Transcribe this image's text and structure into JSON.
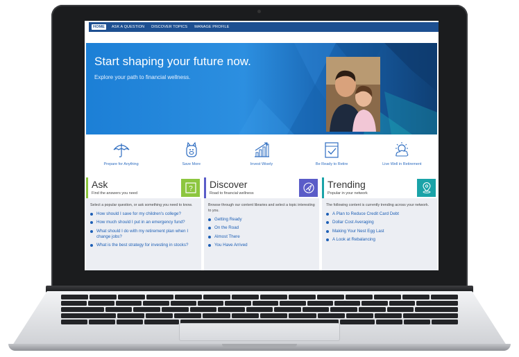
{
  "nav": {
    "items": [
      {
        "label": "HOME",
        "active": true
      },
      {
        "label": "ASK A QUESTION",
        "active": false
      },
      {
        "label": "DISCOVER TOPICS",
        "active": false
      },
      {
        "label": "MANAGE PROFILE",
        "active": false
      }
    ]
  },
  "hero": {
    "title": "Start shaping your future now.",
    "subtitle": "Explore your path to financial wellness."
  },
  "categories": [
    {
      "label": "Prepare for Anything",
      "icon": "umbrella-icon"
    },
    {
      "label": "Save More",
      "icon": "piggy-bank-icon"
    },
    {
      "label": "Invest Wisely",
      "icon": "growth-chart-icon"
    },
    {
      "label": "Be Ready to Retire",
      "icon": "calendar-check-icon"
    },
    {
      "label": "Live Well in Retirement",
      "icon": "sun-cloud-icon"
    }
  ],
  "cards": {
    "ask": {
      "title": "Ask",
      "subtitle": "Find the answers you need",
      "intro": "Select a popular question, or ask something you need to know.",
      "icon": "question-icon",
      "color": "#8dc63f",
      "items": [
        "How should I save for my children's college?",
        "How much should I put in an emergency fund?",
        "What should I do with my retirement plan when I change jobs?",
        "What is the best strategy for investing in stocks?"
      ]
    },
    "discover": {
      "title": "Discover",
      "subtitle": "Road to financial wellness",
      "intro": "Browse through our content libraries and select a topic interesting to you.",
      "icon": "compass-icon",
      "color": "#5a5cc8",
      "items": [
        "Getting Ready",
        "On the Road",
        "Almost There",
        "You Have Arrived"
      ]
    },
    "trending": {
      "title": "Trending",
      "subtitle": "Popular in your network",
      "intro": "The following content is currently trending across your network.",
      "icon": "map-pin-icon",
      "color": "#1aa3a8",
      "items": [
        "A Plan to Reduce Credit Card Debt",
        "Dollar Cost Averaging",
        "Making Your Nest Egg Last",
        "A Look at Rebalancing"
      ]
    }
  },
  "colors": {
    "nav": "#1d4f91",
    "hero": "#1c7fd6",
    "link": "#1d5fb5"
  }
}
